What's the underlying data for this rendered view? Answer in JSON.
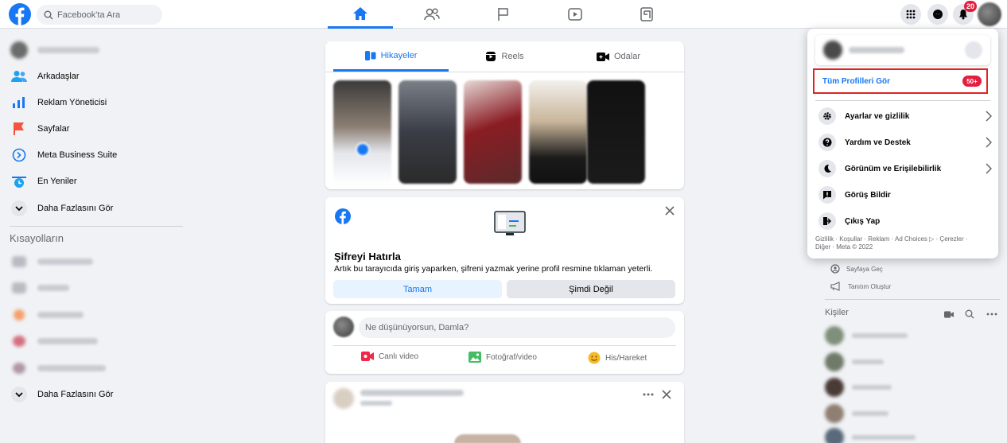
{
  "topbar": {
    "search_placeholder": "Facebook'ta Ara",
    "notification_count": "20"
  },
  "left_sidebar": {
    "items": [
      {
        "label": "Arkadaşlar",
        "icon": "friends-icon"
      },
      {
        "label": "Reklam Yöneticisi",
        "icon": "ads-manager-icon"
      },
      {
        "label": "Sayfalar",
        "icon": "pages-flag-icon"
      },
      {
        "label": "Meta Business Suite",
        "icon": "business-suite-icon"
      },
      {
        "label": "En Yeniler",
        "icon": "most-recent-icon"
      },
      {
        "label": "Daha Fazlasını Gör",
        "icon": "chevron-down-icon"
      }
    ],
    "shortcuts_title": "Kısayolların",
    "shortcuts_see_more": "Daha Fazlasını Gör"
  },
  "stories": {
    "tabs": [
      {
        "label": "Hikayeler",
        "icon": "stories-icon"
      },
      {
        "label": "Reels",
        "icon": "reels-icon"
      },
      {
        "label": "Odalar",
        "icon": "rooms-video-icon"
      }
    ]
  },
  "password_card": {
    "title": "Şifreyi Hatırla",
    "text": "Artık bu tarayıcıda giriş yaparken, şifreni yazmak yerine profil resmine tıklaman yeterli.",
    "ok_label": "Tamam",
    "not_now_label": "Şimdi Değil"
  },
  "composer": {
    "placeholder": "Ne düşünüyorsun, Damla?",
    "actions": [
      {
        "label": "Canlı video",
        "icon": "live-video-icon",
        "color": "#f02849"
      },
      {
        "label": "Fotoğraf/video",
        "icon": "photo-video-icon",
        "color": "#45bd62"
      },
      {
        "label": "His/Hareket",
        "icon": "feeling-icon",
        "color": "#f7b928"
      }
    ]
  },
  "account_menu": {
    "see_all_profiles": "Tüm Profilleri Gör",
    "profiles_badge": "50+",
    "items": [
      {
        "label": "Ayarlar ve gizlilik",
        "icon": "gear-icon",
        "chevron": true
      },
      {
        "label": "Yardım ve Destek",
        "icon": "help-icon",
        "chevron": true
      },
      {
        "label": "Görünüm ve Erişilebilirlik",
        "icon": "moon-icon",
        "chevron": true
      },
      {
        "label": "Görüş Bildir",
        "icon": "feedback-icon",
        "chevron": false
      },
      {
        "label": "Çıkış Yap",
        "icon": "logout-icon",
        "chevron": false
      }
    ],
    "footer_line1": "Gizlilik · Koşullar · Reklam · Ad Choices ▷ · Çerezler ·",
    "footer_line2": "Diğer · Meta © 2022"
  },
  "right_column": {
    "switch_page": "Sayfaya Geç",
    "create_promotion": "Tanıtım Oluştur",
    "contacts_title": "Kişiler"
  },
  "colors": {
    "brand": "#1877f2",
    "background": "#f0f2f5",
    "highlight_box": "#e02424",
    "badge": "#e41e3f"
  }
}
